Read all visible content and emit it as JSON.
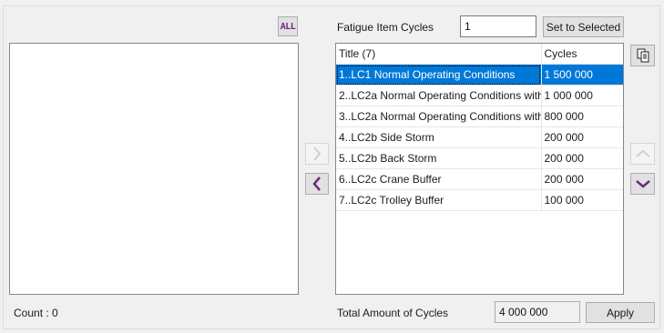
{
  "left_panel": {
    "all_button_label": "ALL",
    "count_label": "Count : 0"
  },
  "right_panel": {
    "fatigue_label": "Fatigue Item Cycles",
    "fatigue_value": "1",
    "set_button_label": "Set to Selected",
    "columns": [
      "Title (7)",
      "Cycles"
    ],
    "rows": [
      {
        "title": "1..LC1 Normal Operating Conditions",
        "cycles": "1 500 000",
        "selected": true
      },
      {
        "title": "2..LC2a Normal Operating Conditions with",
        "cycles": "1 000 000",
        "selected": false
      },
      {
        "title": "3..LC2a Normal Operating Conditions with",
        "cycles": "800 000",
        "selected": false
      },
      {
        "title": "4..LC2b Side Storm",
        "cycles": "200 000",
        "selected": false
      },
      {
        "title": "5..LC2b Back Storm",
        "cycles": "200 000",
        "selected": false
      },
      {
        "title": "6..LC2c Crane Buffer",
        "cycles": "200 000",
        "selected": false
      },
      {
        "title": "7..LC2c Trolley Buffer",
        "cycles": "100 000",
        "selected": false
      }
    ],
    "total_label": "Total Amount of Cycles",
    "total_value": "4 000 000",
    "apply_label": "Apply"
  },
  "icons": {
    "move_right": "chevron-right-icon",
    "move_left": "chevron-left-icon",
    "move_up": "chevron-up-icon",
    "move_down": "chevron-down-icon",
    "copy": "copy-icon"
  },
  "colors": {
    "selection": "#0078d7",
    "accent_purple": "#6b2a7e"
  }
}
